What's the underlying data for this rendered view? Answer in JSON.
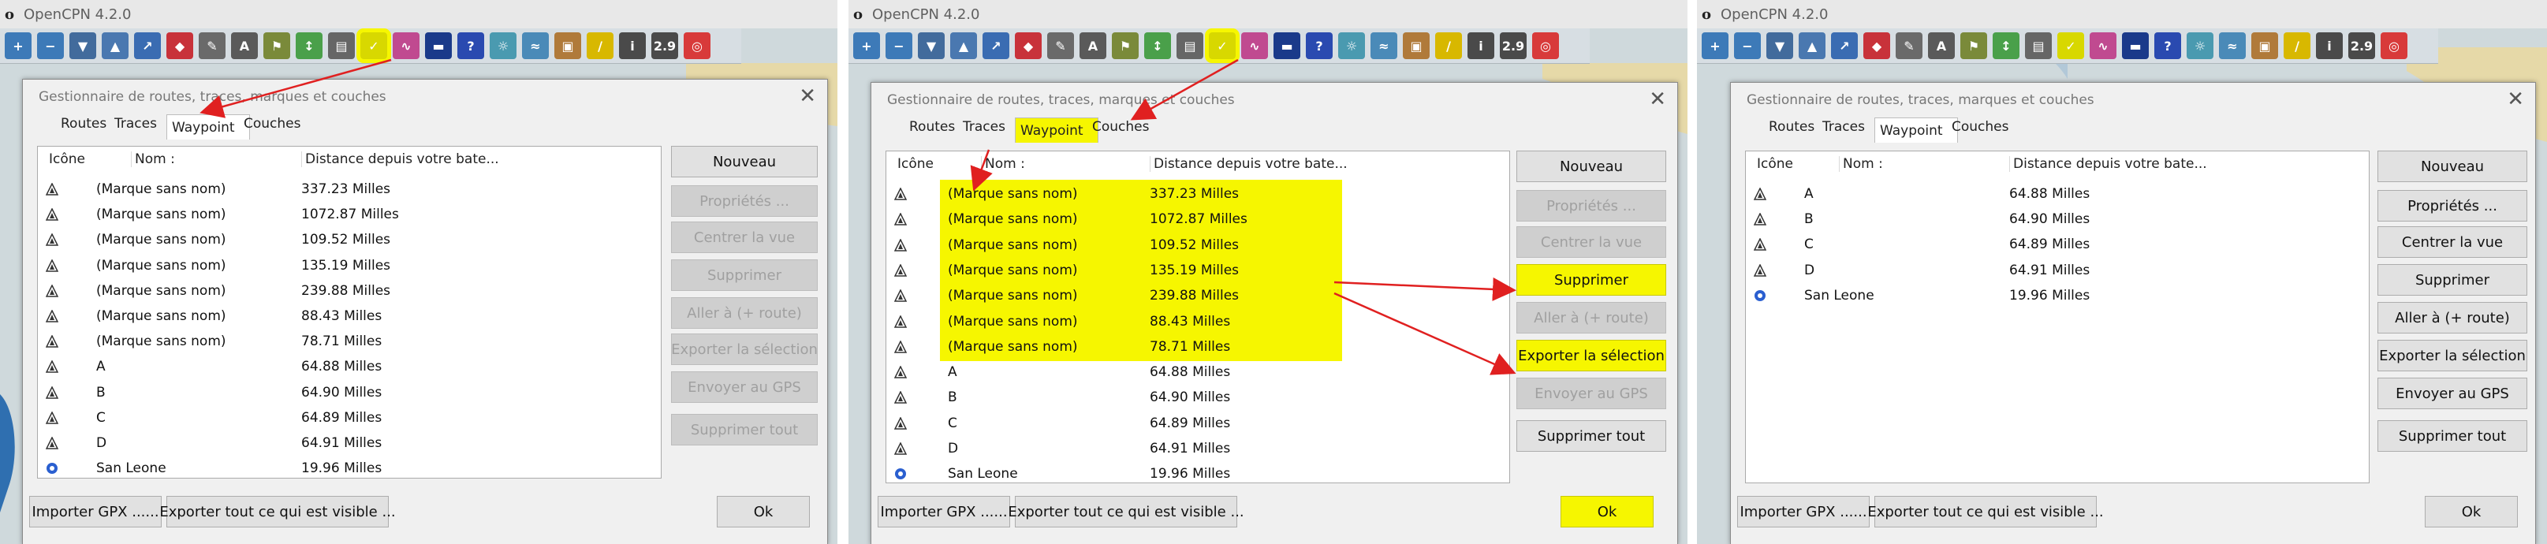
{
  "app": {
    "title": "OpenCPN 4.2.0",
    "logo": "o"
  },
  "toolbar_icons": [
    {
      "name": "zoom-in-icon",
      "color": "#3d7ab8",
      "glyph": "+"
    },
    {
      "name": "zoom-out-icon",
      "color": "#3d7ab8",
      "glyph": "−"
    },
    {
      "name": "scale-icon",
      "color": "#426b9c",
      "glyph": "▼"
    },
    {
      "name": "nav-arrow-icon",
      "color": "#4a78b0",
      "glyph": "▲"
    },
    {
      "name": "route-icon",
      "color": "#3a6cb2",
      "glyph": "↗"
    },
    {
      "name": "boat-icon",
      "color": "#c8323a",
      "glyph": "◆"
    },
    {
      "name": "tools-icon",
      "color": "#6a6a6a",
      "glyph": "✎"
    },
    {
      "name": "text-icon",
      "color": "#5a5a5a",
      "glyph": "A"
    },
    {
      "name": "mark-icon",
      "color": "#7a8a3a",
      "glyph": "⚑"
    },
    {
      "name": "tide-icon",
      "color": "#4aa04a",
      "glyph": "↕"
    },
    {
      "name": "print-icon",
      "color": "#666666",
      "glyph": "▤"
    },
    {
      "name": "route-manager-icon",
      "color": "#d8d800",
      "glyph": "✓"
    },
    {
      "name": "track-icon",
      "color": "#c04a90",
      "glyph": "∿"
    },
    {
      "name": "color-scheme-icon",
      "color": "#1a3a8a",
      "glyph": "▬"
    },
    {
      "name": "help-icon",
      "color": "#2a4ab0",
      "glyph": "?"
    },
    {
      "name": "settings-icon",
      "color": "#4a9ab0",
      "glyph": "☼"
    },
    {
      "name": "chart-icon",
      "color": "#4a8ab8",
      "glyph": "≈"
    },
    {
      "name": "photo-icon",
      "color": "#b07a3a",
      "glyph": "▣"
    },
    {
      "name": "ruler-icon",
      "color": "#d8b800",
      "glyph": "/"
    },
    {
      "name": "info-icon",
      "color": "#4a4a4a",
      "glyph": "i"
    },
    {
      "name": "version-badge",
      "color": "#4a4a4a",
      "glyph": "2.9"
    },
    {
      "name": "lifebuoy-icon",
      "color": "#d83a3a",
      "glyph": "◎"
    }
  ],
  "dialog": {
    "title": "Gestionnaire de routes, traces, marques et couches",
    "close": "✕",
    "tabs": [
      "Routes",
      "Traces",
      "Waypoint",
      "Couches"
    ],
    "columns": {
      "icon": "Icône",
      "name": "Nom :",
      "distance": "Distance depuis votre bate..."
    },
    "buttons": {
      "new": "Nouveau",
      "properties": "Propriétés ...",
      "center": "Centrer la vue",
      "delete": "Supprimer",
      "goto": "Aller à (+ route)",
      "export_sel": "Exporter la sélection",
      "send_gps": "Envoyer au GPS",
      "delete_all": "Supprimer tout"
    },
    "bottom": {
      "import": "Importer GPX ......",
      "export_visible": "Exporter tout ce qui est visible ...",
      "ok": "Ok"
    }
  },
  "waypoints_full": [
    {
      "name": "(Marque sans nom)",
      "distance": "337.23 Milles",
      "icon": "triangle"
    },
    {
      "name": "(Marque sans nom)",
      "distance": "1072.87 Milles",
      "icon": "triangle"
    },
    {
      "name": "(Marque sans nom)",
      "distance": "109.52 Milles",
      "icon": "triangle"
    },
    {
      "name": "(Marque sans nom)",
      "distance": "135.19 Milles",
      "icon": "triangle"
    },
    {
      "name": "(Marque sans nom)",
      "distance": "239.88 Milles",
      "icon": "triangle"
    },
    {
      "name": "(Marque sans nom)",
      "distance": "88.43 Milles",
      "icon": "triangle"
    },
    {
      "name": "(Marque sans nom)",
      "distance": "78.71 Milles",
      "icon": "triangle"
    },
    {
      "name": "A",
      "distance": "64.88 Milles",
      "icon": "triangle"
    },
    {
      "name": "B",
      "distance": "64.90 Milles",
      "icon": "triangle"
    },
    {
      "name": "C",
      "distance": "64.89 Milles",
      "icon": "triangle"
    },
    {
      "name": "D",
      "distance": "64.91 Milles",
      "icon": "triangle"
    },
    {
      "name": "San Leone",
      "distance": "19.96 Milles",
      "icon": "circle"
    }
  ],
  "waypoints_after": [
    {
      "name": "A",
      "distance": "64.88 Milles",
      "icon": "triangle"
    },
    {
      "name": "B",
      "distance": "64.90 Milles",
      "icon": "triangle"
    },
    {
      "name": "C",
      "distance": "64.89 Milles",
      "icon": "triangle"
    },
    {
      "name": "D",
      "distance": "64.91 Milles",
      "icon": "triangle"
    },
    {
      "name": "San Leone",
      "distance": "19.96 Milles",
      "icon": "circle"
    }
  ],
  "colors": {
    "highlight": "#f6f600",
    "annotation_arrow": "#e02020",
    "sea": "#cfd9dc",
    "land": "#e6d9a8"
  }
}
